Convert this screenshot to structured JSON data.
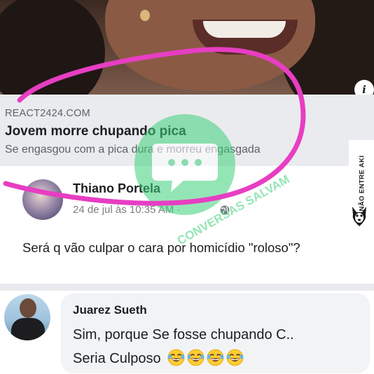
{
  "link_preview": {
    "domain": "REACT2424.COM",
    "title": "Jovem morre chupando pica",
    "description": "Se engasgou com a pica dura e morreu engasgada",
    "info_glyph": "i"
  },
  "post": {
    "author": "Thiano Portela",
    "timestamp": "24 de jul às 10:35 AM · ",
    "text": "Será q vão culpar o cara por homicídio \"roloso\"?"
  },
  "comment": {
    "author": "Juarez Sueth",
    "line1": "Sim, porque Se fosse chupando C..",
    "line2": "Seria Culposo",
    "emoji_count": 4,
    "emoji_icon": "laughing-crying-face-icon"
  },
  "watermarks": {
    "side_text": "NÃO ENTRE AKI",
    "center_text": "CONVERSAS SALVAM"
  },
  "colors": {
    "highlight_circle": "#e73ec2",
    "watermark_green": "#3ed07a",
    "text_primary": "#1c1e21",
    "text_secondary": "#5d6169"
  }
}
